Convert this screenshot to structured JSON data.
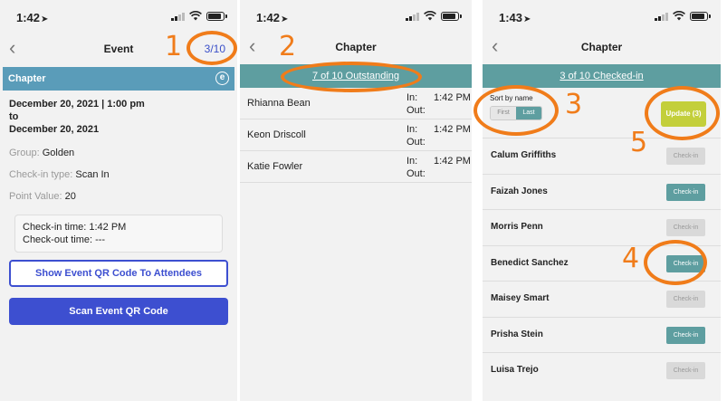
{
  "screen1": {
    "time": "1:42",
    "title": "Event",
    "counter": "3/10",
    "chapter_label": "Chapter",
    "chapter_icon": "e",
    "date_start": "December 20, 2021 | 1:00 pm",
    "date_to": "to",
    "date_end": "December 20, 2021",
    "group_label": "Group:",
    "group_value": "Golden",
    "checkin_type_label": "Check-in type:",
    "checkin_type_value": "Scan In",
    "point_label": "Point Value:",
    "point_value": "20",
    "checkin_time": "Check-in time: 1:42 PM",
    "checkout_time": "Check-out time:  ---",
    "show_qr_button": "Show Event QR Code To Attendees",
    "scan_qr_button": "Scan Event QR Code"
  },
  "screen2": {
    "time": "1:42",
    "title": "Chapter",
    "outstanding_link": "7 of 10 Outstanding",
    "rows": [
      {
        "name": "Rhianna Bean",
        "in_label": "In:",
        "out_label": "Out:",
        "in_time": "1:42 PM"
      },
      {
        "name": "Keon Driscoll",
        "in_label": "In:",
        "out_label": "Out:",
        "in_time": "1:42 PM"
      },
      {
        "name": "Katie Fowler",
        "in_label": "In:",
        "out_label": "Out:",
        "in_time": "1:42 PM"
      }
    ]
  },
  "screen3": {
    "time": "1:43",
    "title": "Chapter",
    "checked_in_link": "3 of 10 Checked-in",
    "sort_label": "Sort by name",
    "sort_first": "First",
    "sort_last": "Last",
    "update_button": "Update (3)",
    "rows": [
      {
        "name": "Calum Griffiths",
        "button": "Check-in",
        "active": false
      },
      {
        "name": "Faizah Jones",
        "button": "Check-in",
        "active": true
      },
      {
        "name": "Morris Penn",
        "button": "Check-in",
        "active": false
      },
      {
        "name": "Benedict Sanchez",
        "button": "Check-in",
        "active": true
      },
      {
        "name": "Maisey Smart",
        "button": "Check-in",
        "active": false
      },
      {
        "name": "Prisha Stein",
        "button": "Check-in",
        "active": true
      },
      {
        "name": "Luisa Trejo",
        "button": "Check-in",
        "active": false
      }
    ]
  },
  "annotations": [
    "1",
    "2",
    "3",
    "4",
    "5"
  ],
  "colors": {
    "teal": "#5e9ea0",
    "blue": "#3d4fd0",
    "chapter_bar": "#5a9cb9",
    "update": "#c3cf3b",
    "annotation": "#f07c1a"
  }
}
